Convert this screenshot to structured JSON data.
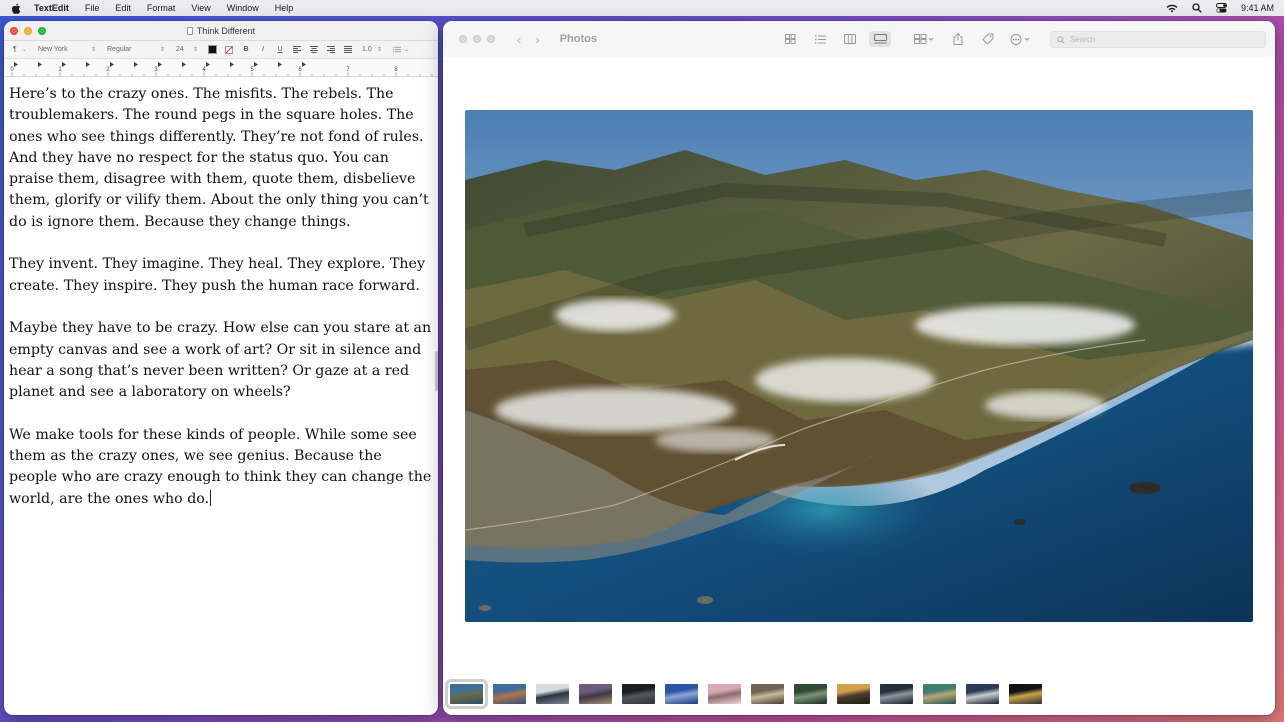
{
  "menubar": {
    "items": [
      "TextEdit",
      "File",
      "Edit",
      "Format",
      "View",
      "Window",
      "Help"
    ],
    "clock": "9:41 AM",
    "icons": [
      "apple-logo-icon",
      "wifi-icon",
      "search-icon",
      "control-center-icon"
    ]
  },
  "textedit": {
    "title": "Think Different",
    "toolbar": {
      "paragraph_style": "¶",
      "font_family": "New York",
      "font_style": "Regular",
      "font_size": "24",
      "line_spacing": "1.0"
    },
    "ruler_labels": [
      "0",
      "1",
      "2",
      "3",
      "4",
      "5",
      "6",
      "7",
      "8"
    ],
    "paragraphs": [
      "Here’s to the crazy ones. The misfits. The rebels. The troublemakers. The round pegs in the square holes. The ones who see things differently. They’re not fond of rules. And they have no respect for the status quo. You can praise them, disagree with them, quote them, disbelieve them, glorify or vilify them. About the only thing you can’t do is ignore them. Because they change things.",
      "They invent. They imagine. They heal. They explore. They create. They inspire. They push the human race forward.",
      "Maybe they have to be crazy. How else can you stare at an empty canvas and see a work of art? Or sit in silence and hear a song that’s never been written? Or gaze at a red planet and see a laboratory on wheels?",
      "We make tools for these kinds of people. While some see them as the crazy ones, we see genius. Because the people who are crazy enough to think they can change the world, are the ones who do."
    ]
  },
  "photos": {
    "title": "Photos",
    "search_placeholder": "Search",
    "thumbnail_count": 14,
    "selected_thumbnail": 0,
    "thumbnails": [
      "coastline-aerial",
      "mountain-sunset",
      "cloud-island",
      "dusk-hills",
      "dark-peaks",
      "blue-abstract",
      "pink-rocks",
      "fog-valley",
      "green-hills",
      "golden-ridge",
      "cliff-shore",
      "bay-aerial",
      "lake-dusk",
      "night-peak"
    ]
  },
  "colors": {
    "accent": "#1a73e8",
    "close": "#ff5f57",
    "minimize": "#febc2e",
    "maximize": "#28c840"
  }
}
